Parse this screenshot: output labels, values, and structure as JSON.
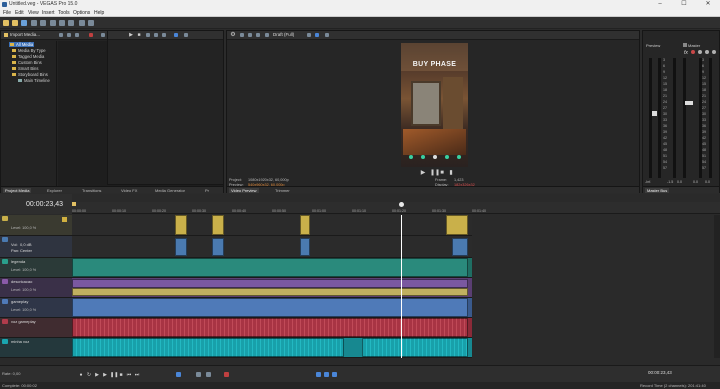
{
  "window": {
    "title": "Untitled.veg - VEGAS Pro 15.0",
    "min": "–",
    "max": "☐",
    "close": "✕"
  },
  "menu": [
    "File",
    "Edit",
    "View",
    "Insert",
    "Tools",
    "Options",
    "Help"
  ],
  "project_media": {
    "toolbar_label": "Import Media...",
    "tree": [
      "All Media",
      "Media By Type",
      "Tagged Media",
      "Custom Bins",
      "Smart Bins",
      "Storyboard Bins",
      "Main Timeline"
    ],
    "tabs": [
      "Project Media",
      "Explorer",
      "Transitions",
      "Video FX",
      "Media Generator",
      "Pr"
    ]
  },
  "preview": {
    "quality": "Draft (Full)",
    "video_text": "BUY PHASE",
    "project_label": "Project:",
    "project_value": "1080x1920x32, 60,000p",
    "preview_label": "Preview:",
    "preview_value": "540x960x32, 60,000p",
    "frame_label": "Frame:",
    "frame_value": "1,423",
    "display_label": "Display:",
    "display_value": "182x326x32",
    "tabs": [
      "Video Preview",
      "Trimmer"
    ]
  },
  "master": {
    "preview_label": "Preview",
    "master_label": "Master",
    "scale": [
      "3",
      "6",
      "9",
      "12",
      "15",
      "18",
      "21",
      "24",
      "27",
      "30",
      "33",
      "36",
      "39",
      "42",
      "45",
      "48",
      "51",
      "54",
      "57"
    ],
    "preview_value": "-Inf.",
    "left_value": "-1.5",
    "right_value": "0.0",
    "master_values": [
      "0.0",
      "0.0"
    ],
    "tabs": [
      "Master Bus"
    ]
  },
  "timeline": {
    "timecode": "00:00:23,43",
    "ruler": [
      "00:00:00",
      "00:00:10",
      "00:00:20",
      "00:00:30",
      "00:00:40",
      "00:00:50",
      "00:01:00",
      "00:01:10",
      "00:01:20",
      "00:01:30",
      "00:01:40"
    ],
    "tracks": [
      {
        "name": "",
        "level": "Level: 100,0 %",
        "color": "#c9b04a",
        "type": "video"
      },
      {
        "name": "Vol:",
        "vol": "0,0 dB",
        "pan": "Pan:",
        "panv": "Center",
        "color": "#4a7ab0",
        "type": "audio"
      },
      {
        "name": "legenda",
        "level": "Level: 100,0 %",
        "color": "#2aa08c",
        "type": "video"
      },
      {
        "name": "descricacao",
        "level": "Level: 100,0 %",
        "color": "#8a5aa8",
        "type": "video"
      },
      {
        "name": "gameplay",
        "level": "Level: 100,0 %",
        "color": "#4f7ab8",
        "type": "video"
      },
      {
        "name": "voz gameplay",
        "level": "",
        "color": "#b03c4c",
        "type": "audio"
      },
      {
        "name": "minha voz",
        "level": "",
        "color": "#1aa6b0",
        "type": "audio"
      }
    ]
  },
  "transport": {
    "timecode": "00:00:23,43",
    "rate_label": "Rate: 0,00"
  },
  "status": {
    "complete": "Complete: 00:00:02",
    "record": "Record Time (2 channels): 201:41:40"
  }
}
